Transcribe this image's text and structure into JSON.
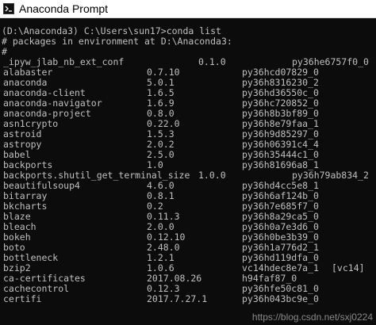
{
  "window": {
    "title": "Anaconda Prompt"
  },
  "console": {
    "command_line": "(D:\\Anaconda3) C:\\Users\\sun17>conda list",
    "header_comment": "# packages in environment at D:\\Anaconda3:",
    "hash_line": "#",
    "packages": [
      {
        "name": "_ipyw_jlab_nb_ext_conf",
        "version": "0.1.0",
        "build": "py36he6757f0_0"
      },
      {
        "name": "alabaster",
        "version": "0.7.10",
        "build": "py36hcd07829_0"
      },
      {
        "name": "anaconda",
        "version": "5.0.1",
        "build": "py36h8316230_2"
      },
      {
        "name": "anaconda-client",
        "version": "1.6.5",
        "build": "py36hd36550c_0"
      },
      {
        "name": "anaconda-navigator",
        "version": "1.6.9",
        "build": "py36hc720852_0"
      },
      {
        "name": "anaconda-project",
        "version": "0.8.0",
        "build": "py36h8b3bf89_0"
      },
      {
        "name": "asn1crypto",
        "version": "0.22.0",
        "build": "py36h8e79faa_1"
      },
      {
        "name": "astroid",
        "version": "1.5.3",
        "build": "py36h9d85297_0"
      },
      {
        "name": "astropy",
        "version": "2.0.2",
        "build": "py36h06391c4_4"
      },
      {
        "name": "babel",
        "version": "2.5.0",
        "build": "py36h35444c1_0"
      },
      {
        "name": "backports",
        "version": "1.0",
        "build": "py36h81696a8_1"
      },
      {
        "name": "backports.shutil_get_terminal_size",
        "version": "1.0.0",
        "build": "py36h79ab834_2"
      },
      {
        "name": "beautifulsoup4",
        "version": "4.6.0",
        "build": "py36hd4cc5e8_1"
      },
      {
        "name": "bitarray",
        "version": "0.8.1",
        "build": "py36h6af124b_0"
      },
      {
        "name": "bkcharts",
        "version": "0.2",
        "build": "py36h7e685f7_0"
      },
      {
        "name": "blaze",
        "version": "0.11.3",
        "build": "py36h8a29ca5_0"
      },
      {
        "name": "bleach",
        "version": "2.0.0",
        "build": "py36h0a7e3d6_0"
      },
      {
        "name": "bokeh",
        "version": "0.12.10",
        "build": "py36h0be3b39_0"
      },
      {
        "name": "boto",
        "version": "2.48.0",
        "build": "py36h1a776d2_1"
      },
      {
        "name": "bottleneck",
        "version": "1.2.1",
        "build": "py36hd119dfa_0"
      },
      {
        "name": "bzip2",
        "version": "1.0.6",
        "build": "vc14hdec8e7a_1",
        "channel": "[vc14]"
      },
      {
        "name": "ca-certificates",
        "version": "2017.08.26",
        "build": "h94faf87_0"
      },
      {
        "name": "cachecontrol",
        "version": "0.12.3",
        "build": "py36hfe50c81_0"
      },
      {
        "name": "certifi",
        "version": "2017.7.27.1",
        "build": "py36h043bc9e_0"
      }
    ]
  },
  "watermark": {
    "text": "https://blog.csdn.net/sxj0224"
  },
  "colors": {
    "background": "#0c0c0c",
    "text": "#c0c0c0",
    "titlebar": "#ffffff"
  }
}
